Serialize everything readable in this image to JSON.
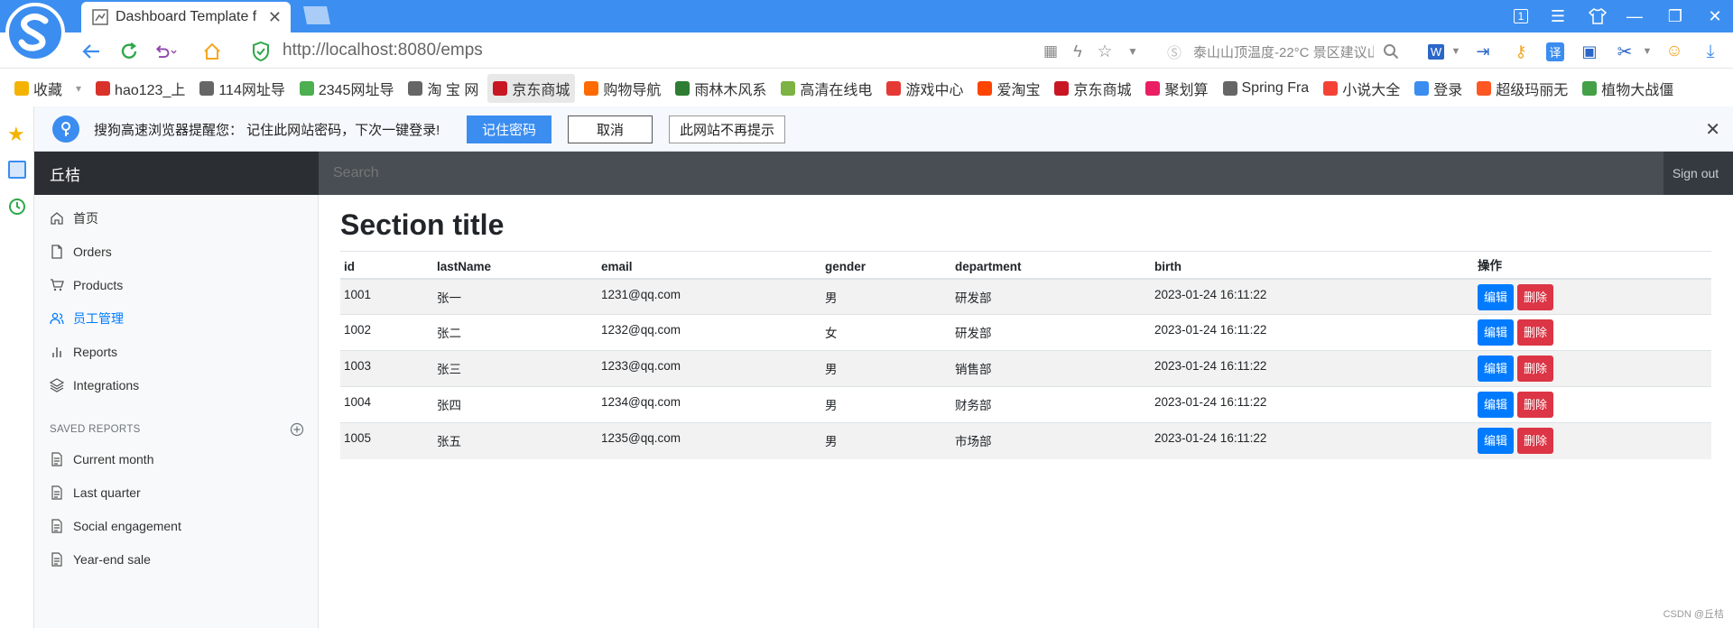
{
  "browser": {
    "tab_title": "Dashboard Template f",
    "url": "http://localhost:8080/emps",
    "weather": "泰山山顶温度-22°C 景区建议山",
    "window_badge": "1"
  },
  "bookmarks": [
    {
      "label": "收藏",
      "color": "#f5b301"
    },
    {
      "label": "hao123_上",
      "color": "#d8322b"
    },
    {
      "label": "114网址导",
      "color": "#666666"
    },
    {
      "label": "2345网址导",
      "color": "#4caf50"
    },
    {
      "label": "淘 宝 网",
      "color": "#666666"
    },
    {
      "label": "京东商城",
      "color": "#c81623"
    },
    {
      "label": "购物导航",
      "color": "#ff6a00"
    },
    {
      "label": "雨林木风系",
      "color": "#2e7d32"
    },
    {
      "label": "高清在线电",
      "color": "#7cb342"
    },
    {
      "label": "游戏中心",
      "color": "#e53935"
    },
    {
      "label": "爱淘宝",
      "color": "#ff4400"
    },
    {
      "label": "京东商城",
      "color": "#c81623"
    },
    {
      "label": "聚划算",
      "color": "#e91e63"
    },
    {
      "label": "Spring Fra",
      "color": "#666666"
    },
    {
      "label": "小说大全",
      "color": "#f44336"
    },
    {
      "label": "登录",
      "color": "#3b8df0"
    },
    {
      "label": "超级玛丽无",
      "color": "#ff5722"
    },
    {
      "label": "植物大战僵",
      "color": "#43a047"
    }
  ],
  "password_bar": {
    "message": "搜狗高速浏览器提醒您：  记住此网站密码，下次一键登录!",
    "remember": "记住密码",
    "cancel": "取消",
    "never": "此网站不再提示"
  },
  "navbar": {
    "brand": "丘桔",
    "search_placeholder": "Search",
    "sign_out": "Sign out"
  },
  "sidebar": {
    "items": [
      {
        "label": "首页",
        "icon": "home-icon"
      },
      {
        "label": "Orders",
        "icon": "file-icon"
      },
      {
        "label": "Products",
        "icon": "cart-icon"
      },
      {
        "label": "员工管理",
        "icon": "users-icon"
      },
      {
        "label": "Reports",
        "icon": "bar-chart-icon"
      },
      {
        "label": "Integrations",
        "icon": "layers-icon"
      }
    ],
    "saved_heading": "SAVED REPORTS",
    "saved": [
      {
        "label": "Current month"
      },
      {
        "label": "Last quarter"
      },
      {
        "label": "Social engagement"
      },
      {
        "label": "Year-end sale"
      }
    ]
  },
  "main": {
    "title": "Section title",
    "columns": [
      "id",
      "lastName",
      "email",
      "gender",
      "department",
      "birth",
      "操作"
    ],
    "rows": [
      [
        "1001",
        "张一",
        "1231@qq.com",
        "男",
        "研发部",
        "2023-01-24 16:11:22"
      ],
      [
        "1002",
        "张二",
        "1232@qq.com",
        "女",
        "研发部",
        "2023-01-24 16:11:22"
      ],
      [
        "1003",
        "张三",
        "1233@qq.com",
        "男",
        "销售部",
        "2023-01-24 16:11:22"
      ],
      [
        "1004",
        "张四",
        "1234@qq.com",
        "男",
        "财务部",
        "2023-01-24 16:11:22"
      ],
      [
        "1005",
        "张五",
        "1235@qq.com",
        "男",
        "市场部",
        "2023-01-24 16:11:22"
      ]
    ],
    "edit_label": "编辑",
    "delete_label": "删除"
  },
  "watermark": "CSDN @丘桔"
}
